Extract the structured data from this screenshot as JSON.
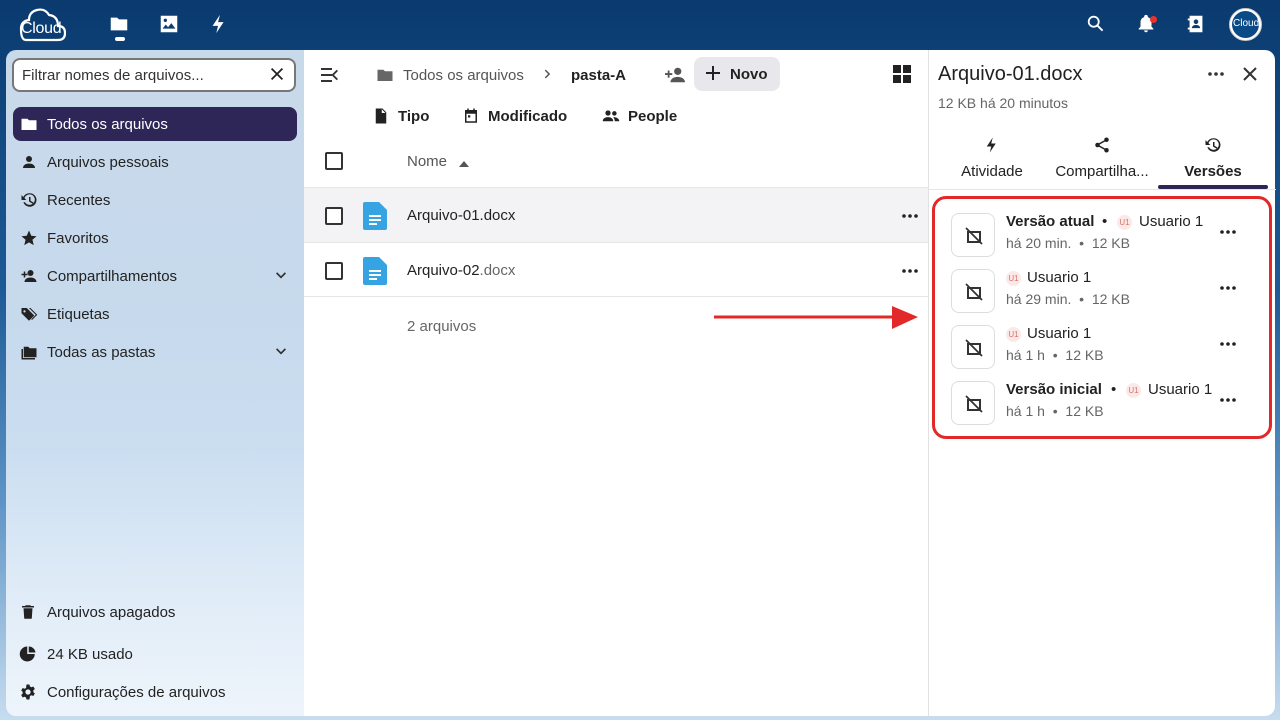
{
  "topbar": {
    "logo_text": "Cloud",
    "apps": [
      "files-icon",
      "photos-icon",
      "activity-icon"
    ],
    "avatar_text": "Cloud"
  },
  "sidebar": {
    "filter_placeholder": "Filtrar nomes de arquivos...",
    "items": [
      {
        "label": "Todos os arquivos",
        "icon": "folder-icon",
        "active": true
      },
      {
        "label": "Arquivos pessoais",
        "icon": "user-icon"
      },
      {
        "label": "Recentes",
        "icon": "history-icon"
      },
      {
        "label": "Favoritos",
        "icon": "star-icon"
      },
      {
        "label": "Compartilhamentos",
        "icon": "share-user-icon",
        "expandable": true
      },
      {
        "label": "Etiquetas",
        "icon": "tag-icon"
      },
      {
        "label": "Todas as pastas",
        "icon": "folders-icon",
        "expandable": true
      }
    ],
    "bottom": {
      "trash": "Arquivos apagados",
      "quota": "24 KB usado",
      "settings": "Configurações de arquivos"
    }
  },
  "main": {
    "breadcrumb_root": "Todos os arquivos",
    "breadcrumb_current": "pasta-A",
    "new_label": "Novo",
    "filters": {
      "type": "Tipo",
      "modified": "Modificado",
      "people": "People"
    },
    "column_name": "Nome",
    "files": [
      {
        "name": "Arquivo-01.docx",
        "base": "Arquivo-01.docx",
        "ext": ""
      },
      {
        "name": "Arquivo-02.docx",
        "base": "Arquivo-02",
        "ext": ".docx"
      }
    ],
    "summary": "2 arquivos"
  },
  "details": {
    "title": "Arquivo-01.docx",
    "subtitle": "12 KB há 20 minutos",
    "tabs": [
      "Atividade",
      "Compartilha...",
      "Versões"
    ],
    "active_tab": "Versões",
    "versions": [
      {
        "title": "Versão atual",
        "badge": "U1",
        "user": "Usuario 1",
        "age": "há 20 min.",
        "size": "12 KB"
      },
      {
        "title": "",
        "badge": "U1",
        "user": "Usuario 1",
        "age": "há 29 min.",
        "size": "12 KB"
      },
      {
        "title": "",
        "badge": "U1",
        "user": "Usuario 1",
        "age": "há 1 h",
        "size": "12 KB"
      },
      {
        "title": "Versão inicial",
        "badge": "U1",
        "user": "Usuario 1",
        "age": "há 1 h",
        "size": "12 KB"
      }
    ]
  },
  "colors": {
    "accent": "#2d2657",
    "highlight": "#e3282a",
    "doc_icon": "#36a3e3"
  }
}
